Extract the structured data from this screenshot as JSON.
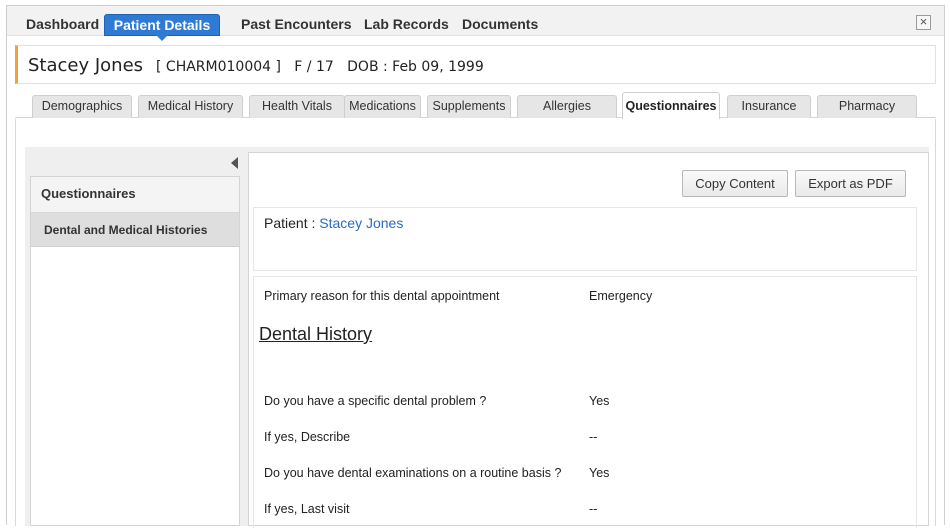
{
  "topnav": {
    "items": [
      "Dashboard",
      "Patient Details",
      "Past Encounters",
      "Lab Records",
      "Documents"
    ],
    "close_icon": "×"
  },
  "patient": {
    "name": "Stacey Jones",
    "meta": "[ CHARM010004 ]   F / 17   DOB : Feb 09, 1999"
  },
  "tabs": [
    "Demographics",
    "Medical History",
    "Health Vitals",
    "Medications",
    "Supplements",
    "Allergies",
    "Questionnaires",
    "Insurance",
    "Pharmacy"
  ],
  "sidebar": {
    "header": "Questionnaires",
    "items": [
      "Dental and Medical Histories"
    ]
  },
  "toolbar": {
    "copy_label": "Copy Content",
    "export_label": "Export as PDF"
  },
  "patient_box": {
    "label": "Patient :",
    "value": "Stacey Jones"
  },
  "questionnaire": {
    "primary_reason": {
      "q": "Primary reason for this dental appointment",
      "a": "Emergency"
    },
    "section_title": "Dental History",
    "rows": [
      {
        "q": "Do you have a specific dental problem ?",
        "a": "Yes"
      },
      {
        "q": "If yes, Describe",
        "a": "--"
      },
      {
        "q": "Do you have dental examinations on a routine basis ?",
        "a": "Yes"
      },
      {
        "q": "If yes, Last visit",
        "a": "--"
      }
    ]
  },
  "colors": {
    "accent_blue": "#2f7bd3",
    "header_border": "#f0a33a",
    "link": "#2a6ac2"
  }
}
